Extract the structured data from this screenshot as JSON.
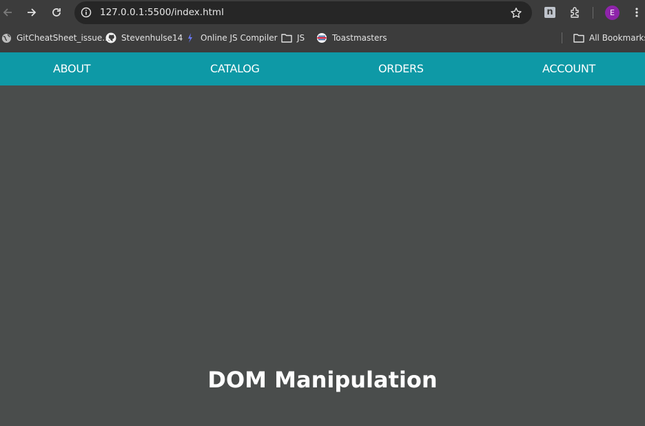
{
  "browser": {
    "url": "127.0.0.1:5500/index.html",
    "profile_initial": "E",
    "extension_label": "n",
    "icons": [
      "back-icon",
      "forward-icon",
      "reload-icon",
      "site-info-icon",
      "bookmark-star-icon",
      "extensions-icon",
      "menu-icon"
    ]
  },
  "bookmarks": {
    "items": [
      {
        "label": "GitCheatSheet_issue...",
        "icon": "globe-icon"
      },
      {
        "label": "Stevenhulse14",
        "icon": "github-icon"
      },
      {
        "label": "Online JS Compiler",
        "icon": "compiler-icon"
      },
      {
        "label": "JS",
        "icon": "folder-icon"
      },
      {
        "label": "Toastmasters",
        "icon": "toastmasters-icon"
      }
    ],
    "all_bookmarks_label": "All Bookmarks"
  },
  "nav": {
    "items": [
      "ABOUT",
      "CATALOG",
      "ORDERS",
      "ACCOUNT"
    ],
    "color": "#0e99a6"
  },
  "main": {
    "heading": "DOM Manipulation",
    "background": "#4a4d4c"
  }
}
